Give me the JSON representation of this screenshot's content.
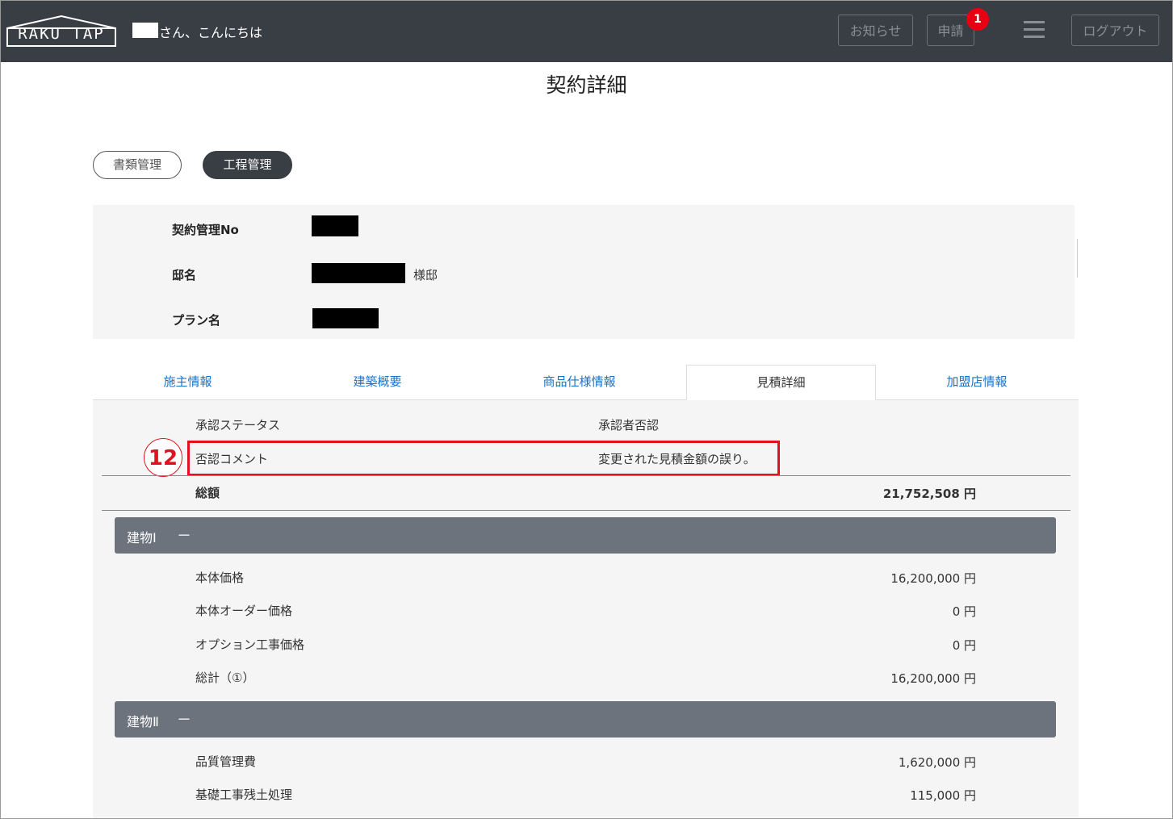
{
  "header": {
    "logo": "RAKU TAP",
    "greeting": "さん、こんにちは",
    "news_label": "お知らせ",
    "apply_label": "申請",
    "apply_badge": "1",
    "logout_label": "ログアウト"
  },
  "page": {
    "title": "契約詳細"
  },
  "pills": {
    "docs": "書類管理",
    "process": "工程管理"
  },
  "info": {
    "contract_no_label": "契約管理No",
    "residence_label": "邸名",
    "residence_suffix": "様邸",
    "plan_label": "プラン名"
  },
  "tabs": [
    "施主情報",
    "建築概要",
    "商品仕様情報",
    "見積詳細",
    "加盟店情報"
  ],
  "estimate": {
    "status_label": "承認ステータス",
    "status_value": "承認者否認",
    "comment_label": "否認コメント",
    "comment_value": "変更された見積金額の誤り。",
    "total_label": "総額",
    "total_value": "21,752,508 円",
    "step_marker": "12"
  },
  "building1": {
    "title": "建物Ⅰ",
    "collapse": "－",
    "rows": [
      {
        "label": "本体価格",
        "amount": "16,200,000 円"
      },
      {
        "label": "本体オーダー価格",
        "amount": "0 円"
      },
      {
        "label": "オプション工事価格",
        "amount": "0 円"
      },
      {
        "label": "総計（①）",
        "amount": "16,200,000 円"
      }
    ]
  },
  "building2": {
    "title": "建物Ⅱ",
    "collapse": "－",
    "rows": [
      {
        "label": "品質管理費",
        "amount": "1,620,000 円"
      },
      {
        "label": "基礎工事残土処理",
        "amount": "115,000 円"
      }
    ]
  },
  "colors": {
    "header_bg": "#393d44",
    "link": "#1a73c8",
    "highlight": "#e0121f",
    "section_bar": "#6c737c",
    "badge": "#e60012"
  }
}
